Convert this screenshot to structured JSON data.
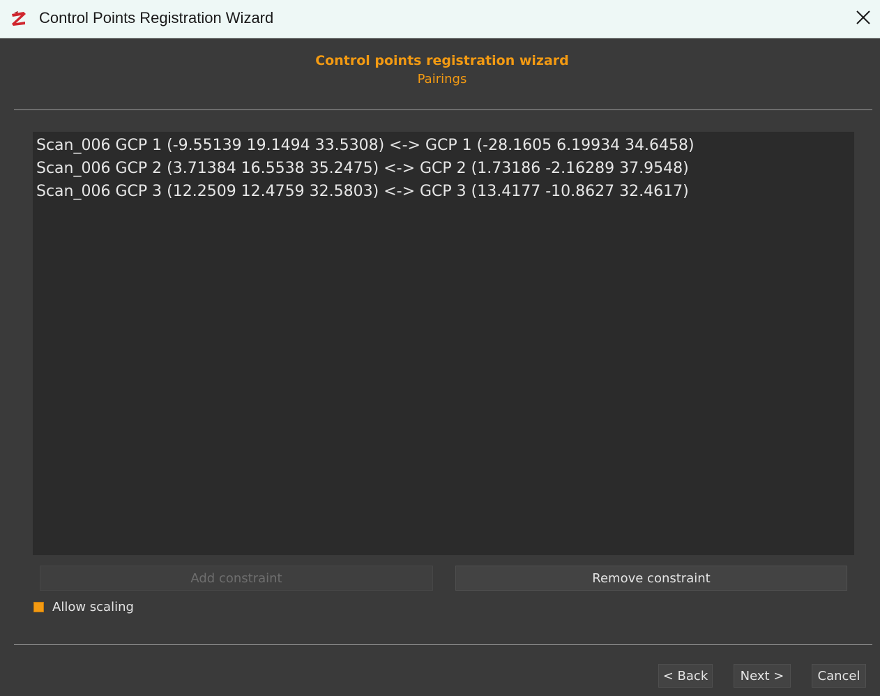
{
  "window": {
    "title": "Control Points Registration Wizard"
  },
  "header": {
    "title": "Control points registration wizard",
    "subtitle": "Pairings"
  },
  "pairings": {
    "items": [
      "Scan_006 GCP 1 (-9.55139 19.1494 33.5308) <-> GCP 1 (-28.1605 6.19934 34.6458)",
      "Scan_006 GCP 2 (3.71384 16.5538 35.2475) <-> GCP 2 (1.73186 -2.16289 37.9548)",
      "Scan_006 GCP 3 (12.2509 12.4759 32.5803) <-> GCP 3 (13.4177 -10.8627 32.4617)"
    ]
  },
  "buttons": {
    "add_constraint": "Add constraint",
    "remove_constraint": "Remove constraint",
    "back": "< Back",
    "next": "Next >",
    "cancel": "Cancel"
  },
  "options": {
    "allow_scaling_label": "Allow scaling",
    "allow_scaling_checked": true
  },
  "colors": {
    "accent": "#f39a12",
    "titlebar_bg": "#eef8f6",
    "panel_bg": "#3a3a3a",
    "list_bg": "#2b2b2b",
    "app_icon": "#d0262e"
  }
}
